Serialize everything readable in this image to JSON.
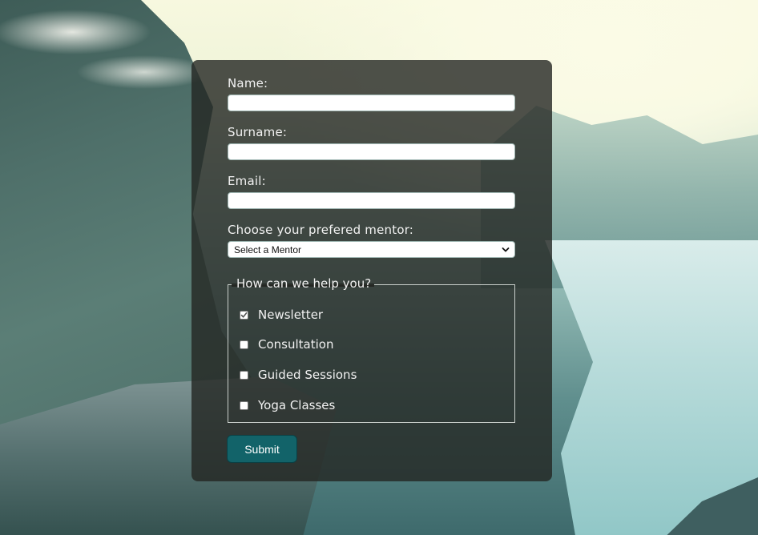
{
  "form": {
    "name_label": "Name:",
    "name_value": "",
    "surname_label": "Surname:",
    "surname_value": "",
    "email_label": "Email:",
    "email_value": "",
    "mentor_label": "Choose your prefered mentor:",
    "mentor_selected": "Select a Mentor",
    "help_legend": "How can we help you?",
    "options": [
      {
        "label": "Newsletter",
        "checked": true
      },
      {
        "label": "Consultation",
        "checked": false
      },
      {
        "label": "Guided Sessions",
        "checked": false
      },
      {
        "label": "Yoga Classes",
        "checked": false
      }
    ],
    "submit_label": "Submit"
  },
  "colors": {
    "panel_bg": "#232622",
    "submit_bg": "#126369",
    "text": "#f2f2f2"
  }
}
